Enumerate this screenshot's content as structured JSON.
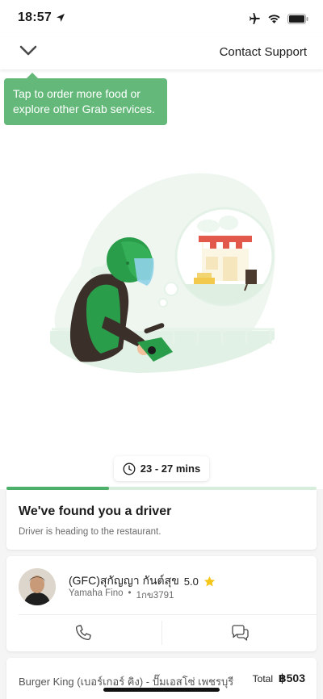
{
  "status_bar": {
    "time": "18:57",
    "icons": [
      "location-arrow-icon",
      "airplane-icon",
      "wifi-icon",
      "battery-icon"
    ]
  },
  "header": {
    "collapse_icon": "chevron-down-icon",
    "contact_support": "Contact Support"
  },
  "tooltip": {
    "text": "Tap to order more food or explore other Grab services."
  },
  "eta": {
    "icon": "clock-icon",
    "text": "23 - 27 mins"
  },
  "progress": {
    "fraction": 0.33,
    "fill_color": "#4caf6a",
    "track_color": "#d8eedd"
  },
  "status_card": {
    "title": "We've found you a driver",
    "subtitle": "Driver is heading to the restaurant."
  },
  "driver": {
    "name": "(GFC)สุกัญญา กันต์สุข",
    "rating": "5.0",
    "rating_icon": "star-icon",
    "vehicle": "Yamaha Fino",
    "separator": "•",
    "plate": "1กข3791",
    "actions": [
      "phone-icon",
      "chat-icon"
    ]
  },
  "order": {
    "restaurant": "Burger King (เบอร์เกอร์ คิง) - ปั๊มเอสโซ่ เพชรบุรี",
    "total_label": "Total",
    "total_value": "฿503"
  },
  "colors": {
    "brand_green": "#00b14f",
    "tooltip_green": "#64b97a",
    "star": "#f5c518"
  }
}
